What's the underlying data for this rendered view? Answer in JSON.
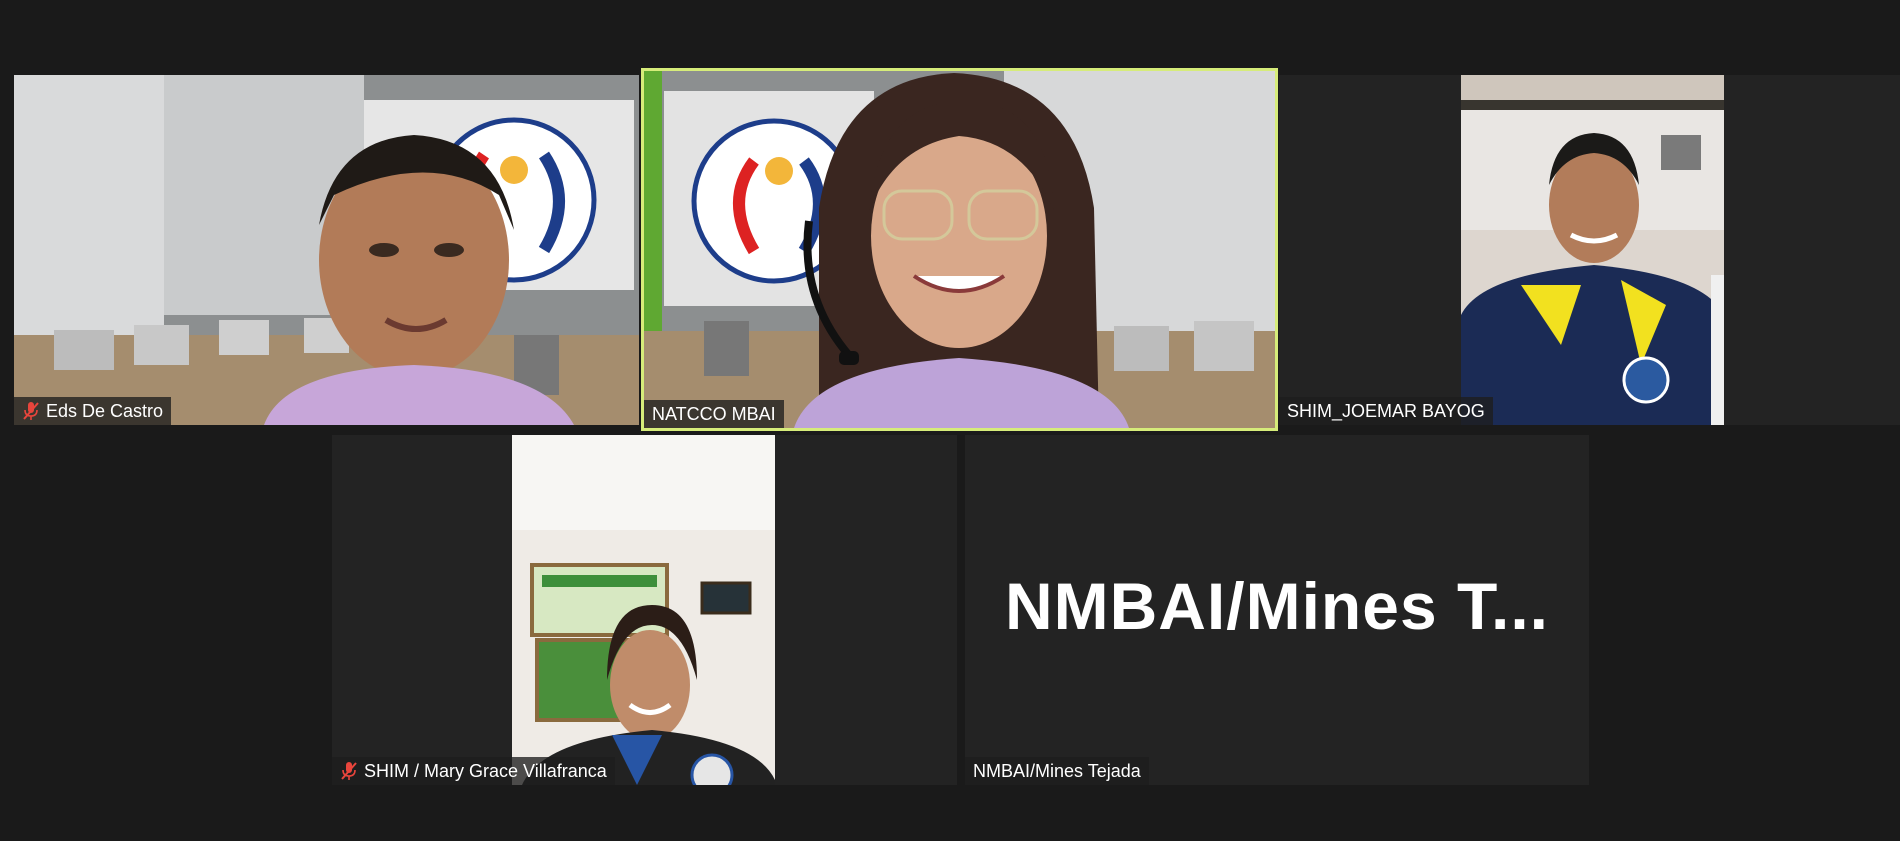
{
  "meeting": {
    "participants": [
      {
        "name": "Eds De Castro",
        "muted": true,
        "video": true,
        "active": false
      },
      {
        "name": "NATCCO MBAI",
        "muted": false,
        "video": true,
        "active": true
      },
      {
        "name": "SHIM_JOEMAR BAYOG",
        "muted": false,
        "video": true,
        "active": false
      },
      {
        "name": "SHIM / Mary Grace Villafranca",
        "muted": true,
        "video": true,
        "active": false
      },
      {
        "name": "NMBAI/Mines Tejada",
        "muted": false,
        "video": false,
        "active": false,
        "placeholder": "NMBAI/Mines T..."
      }
    ]
  },
  "colors": {
    "background": "#1a1a1a",
    "tile": "#232323",
    "active_border": "#d6ec7a",
    "mute_red": "#e8453c"
  }
}
